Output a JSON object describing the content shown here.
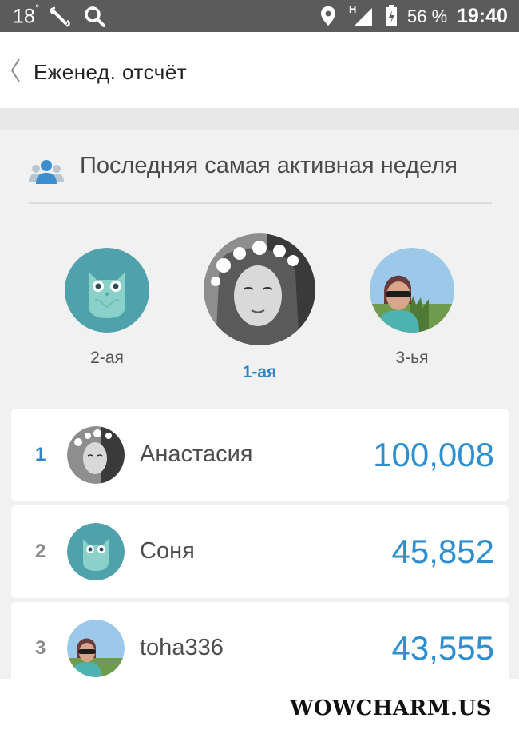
{
  "status_bar": {
    "temperature": "18",
    "degree": "°",
    "network_letter": "H",
    "battery_percent": "56 %",
    "time": "19:40",
    "icons": [
      "weather-icon",
      "wand-icon",
      "search-icon",
      "location-icon",
      "signal-icon",
      "battery-icon"
    ]
  },
  "header": {
    "title": "Еженед. отсчёт",
    "back_icon": "chevron-left-icon"
  },
  "section": {
    "title": "Последняя самая активная неделя",
    "icon": "users-icon"
  },
  "podium": [
    {
      "place_label": "2-ая",
      "avatar": "owl-avatar"
    },
    {
      "place_label": "1-ая",
      "avatar": "girl-flowers-avatar"
    },
    {
      "place_label": "3-ья",
      "avatar": "woman-sunglasses-avatar"
    }
  ],
  "ranking": [
    {
      "rank": "1",
      "name": "Анастасия",
      "score": "100,008",
      "avatar": "girl-flowers-avatar"
    },
    {
      "rank": "2",
      "name": "Соня",
      "score": "45,852",
      "avatar": "owl-avatar"
    },
    {
      "rank": "3",
      "name": "toha336",
      "score": "43,555",
      "avatar": "woman-sunglasses-avatar"
    }
  ],
  "watermark": "WOWCHARM.US",
  "colors": {
    "accent": "#2e8fd0",
    "status_bar": "#5b5b5b",
    "owl_bg": "#4fa1ab",
    "background": "#f1f1f1"
  }
}
